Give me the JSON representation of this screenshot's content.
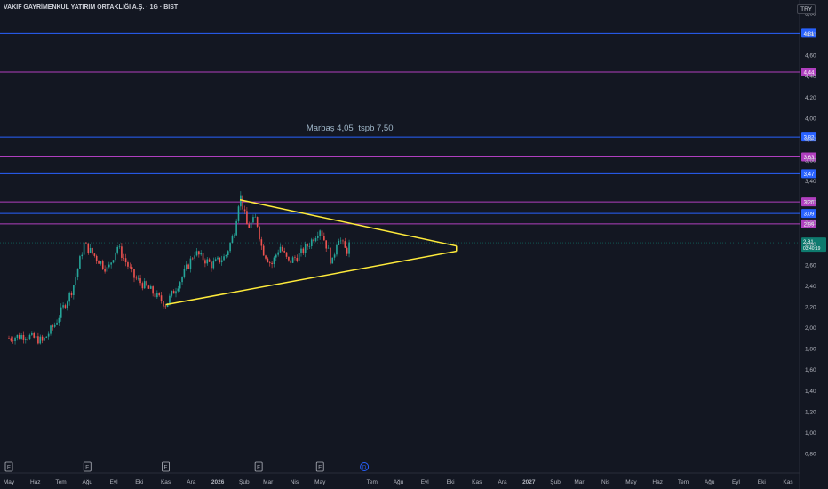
{
  "header": {
    "symbol_title": "VAKIF GAYRİMENKUL YATIRIM ORTAKLIĞI A.Ş. · 1G · BIST",
    "currency": "TRY"
  },
  "colors": {
    "background": "#131722",
    "up": "#26a69a",
    "down": "#ef5350",
    "blue_level": "#2962ff",
    "magenta_level": "#b03fbf",
    "triangle": "#ffeb3b",
    "last_price": "#0e7a6e"
  },
  "chart_data": {
    "type": "candlestick",
    "title": "VAKIF GAYRİMENKUL YATIRIM ORTAKLIĞI A.Ş. · 1G · BIST",
    "ylim": [
      0.8,
      5.0
    ],
    "y_ticks": [
      "5,00",
      "4,80",
      "4,60",
      "4,40",
      "4,20",
      "4,00",
      "3,80",
      "3,60",
      "3,40",
      "3,20",
      "3,00",
      "2,80",
      "2,60",
      "2,40",
      "2,20",
      "2,00",
      "1,80",
      "1,60",
      "1,40",
      "1,20",
      "1,00",
      "0,80"
    ],
    "x_ticks": [
      "May",
      "Haz",
      "Tem",
      "Ağu",
      "Eyl",
      "Eki",
      "Kas",
      "Ara",
      "2026",
      "Şub",
      "Mar",
      "Nis",
      "May",
      "Tem",
      "Ağu",
      "Eyl",
      "Eki",
      "Kas",
      "Ara",
      "2027",
      "Şub",
      "Mar",
      "Nis",
      "May",
      "Haz",
      "Tem",
      "Ağu",
      "Eyl",
      "Eki",
      "Kas"
    ],
    "x_tick_dates": [
      "2025-05",
      "2025-06",
      "2025-07",
      "2025-08",
      "2025-09",
      "2025-10",
      "2025-11",
      "2025-12",
      "2026-01",
      "2026-02",
      "2026-03",
      "2026-04",
      "2026-05",
      "2026-07",
      "2026-08",
      "2026-09",
      "2026-10",
      "2026-11",
      "2026-12",
      "2027-01",
      "2027-02",
      "2027-03",
      "2027-04",
      "2027-05",
      "2027-06",
      "2027-07",
      "2027-08",
      "2027-09",
      "2027-10",
      "2027-11"
    ],
    "price_path": [
      [
        "2025-05-01",
        1.9
      ],
      [
        "2025-05-20",
        1.93
      ],
      [
        "2025-06-10",
        1.87
      ],
      [
        "2025-06-25",
        2.05
      ],
      [
        "2025-07-15",
        2.38
      ],
      [
        "2025-07-28",
        2.8
      ],
      [
        "2025-08-10",
        2.68
      ],
      [
        "2025-08-25",
        2.55
      ],
      [
        "2025-09-05",
        2.78
      ],
      [
        "2025-09-25",
        2.48
      ],
      [
        "2025-10-15",
        2.35
      ],
      [
        "2025-11-01",
        2.22
      ],
      [
        "2025-11-20",
        2.48
      ],
      [
        "2025-12-05",
        2.72
      ],
      [
        "2025-12-25",
        2.6
      ],
      [
        "2026-01-10",
        2.68
      ],
      [
        "2026-01-20",
        2.9
      ],
      [
        "2026-01-27",
        3.28
      ],
      [
        "2026-02-05",
        2.95
      ],
      [
        "2026-02-15",
        3.05
      ],
      [
        "2026-02-22",
        2.75
      ],
      [
        "2026-03-05",
        2.6
      ],
      [
        "2026-03-15",
        2.78
      ],
      [
        "2026-03-25",
        2.62
      ],
      [
        "2026-04-10",
        2.72
      ],
      [
        "2026-04-20",
        2.82
      ],
      [
        "2026-05-01",
        2.95
      ],
      [
        "2026-05-10",
        2.75
      ],
      [
        "2026-05-15",
        2.6
      ],
      [
        "2026-05-22",
        2.88
      ],
      [
        "2026-06-01",
        2.72
      ],
      [
        "2026-06-05",
        2.81
      ]
    ],
    "horizontal_levels": [
      {
        "value": 4.81,
        "color": "blue",
        "label": "4,81"
      },
      {
        "value": 4.44,
        "color": "magenta",
        "label": "4,44"
      },
      {
        "value": 3.82,
        "color": "blue",
        "label": "3,82"
      },
      {
        "value": 3.63,
        "color": "magenta",
        "label": "3,63"
      },
      {
        "value": 3.47,
        "color": "blue",
        "label": "3,47"
      },
      {
        "value": 3.2,
        "color": "magenta",
        "label": "3,20"
      },
      {
        "value": 3.09,
        "color": "blue",
        "label": "3,09"
      },
      {
        "value": 2.99,
        "color": "magenta",
        "label": "2,99"
      }
    ],
    "triangle": {
      "upper": [
        [
          "2026-01-27",
          3.22
        ],
        [
          "2026-10-08",
          2.78
        ]
      ],
      "lower": [
        [
          "2025-11-01",
          2.22
        ],
        [
          "2026-10-08",
          2.73
        ]
      ]
    },
    "last_price": {
      "value": 2.81,
      "label": "2,81",
      "countdown": "03:40:19"
    },
    "annotations": [
      {
        "text": "Marbaş 4,05",
        "date": "2026-04-15",
        "value": 3.88
      },
      {
        "text": "tspb 7,50",
        "date": "2026-06-15",
        "value": 3.88
      }
    ],
    "event_markers": [
      {
        "date": "2025-05-01",
        "label": "E"
      },
      {
        "date": "2025-08-01",
        "label": "E"
      },
      {
        "date": "2025-11-01",
        "label": "E"
      },
      {
        "date": "2026-02-18",
        "label": "E"
      },
      {
        "date": "2026-05-01",
        "label": "E"
      },
      {
        "date": "2026-06-22",
        "label": "D"
      }
    ]
  }
}
